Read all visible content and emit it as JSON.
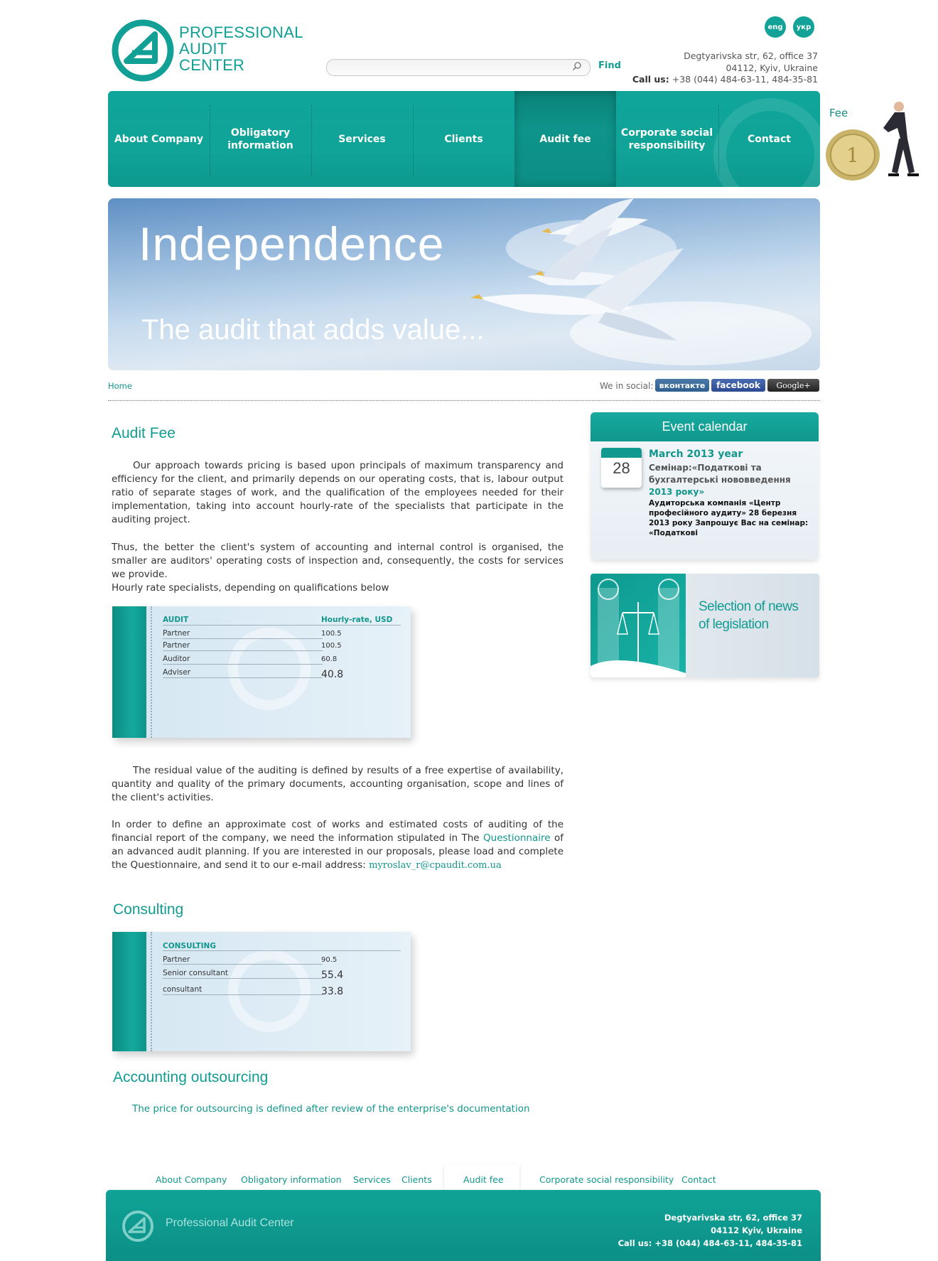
{
  "header": {
    "logo_lines": [
      "PROFESSIONAL",
      "AUDIT",
      "CENTER"
    ],
    "lang": [
      "eng",
      "укр"
    ],
    "search": {
      "value": "",
      "placeholder": ""
    },
    "find_label": "Find",
    "address": [
      "Degtyarivska str, 62, office 37",
      "04112, Kyiv, Ukraine"
    ],
    "call_label": "Call us:",
    "call_numbers": "+38 (044) 484-63-11, 484-35-81"
  },
  "nav": {
    "items": [
      "About Company",
      "Obligatory information",
      "Services",
      "Clients",
      "Audit fee",
      "Corporate social responsibility",
      "Contact"
    ],
    "active": "Audit fee",
    "fee_label": "Fee"
  },
  "banner": {
    "title": "Independence",
    "subtitle": "The audit that adds value..."
  },
  "breadcrumb": {
    "home": "Home"
  },
  "social": {
    "label": "We in social:",
    "vk": "вконтакте",
    "facebook": "facebook",
    "google": "Google+"
  },
  "audit_fee": {
    "heading": "Audit Fee",
    "p1": "Our approach towards pricing is based upon principals of maximum transparency and efficiency for the client, and primarily depends on our operating costs, that is, labour output ratio of separate stages of work, and the qualification of the employees needed for their implementation, taking into account hourly-rate of the specialists that participate in the auditing project.",
    "p2": "Thus, the better the client's system of accounting and internal control is organised, the smaller are auditors' operating costs of inspection and, consequently, the costs for services we provide.",
    "p3": "Hourly rate specialists, depending on qualifications below",
    "table": {
      "col1": "AUDIT",
      "col2": "Hourly-rate, USD",
      "rows": [
        {
          "role": "Partner",
          "rate": "100.5"
        },
        {
          "role": "Partner",
          "rate": "100.5"
        },
        {
          "role": "Auditor",
          "rate": "60.8"
        },
        {
          "role": "Adviser",
          "rate": "40.8"
        }
      ]
    },
    "p4": "The residual value of the auditing is defined by results of a free expertise of availability, quantity and quality of the primary documents, accounting organisation, scope and lines of the client's activities.",
    "p5_before": "In order to define an approximate cost of works and estimated costs of auditing of the financial report of the company, we need the information stipulated in The",
    "p5_link": "Questionnaire",
    "p5_after": "of an advanced audit planning. If you are interested in our proposals, please load and complete the Questionnaire, and send it to our e-mail address:",
    "email": "myroslav_r@cpaudit.com.ua"
  },
  "consulting": {
    "heading": "Consulting",
    "table": {
      "col1": "CONSULTING",
      "rows": [
        {
          "role": "Partner",
          "rate": "90.5"
        },
        {
          "role": "Senior consultant",
          "rate": "55.4"
        },
        {
          "role": "consultant",
          "rate": "33.8"
        }
      ]
    }
  },
  "outsourcing": {
    "heading": "Accounting outsourcing",
    "text": "The price for outsourcing is defined after review of the enterprise's documentation"
  },
  "sidebar": {
    "event_calendar": {
      "heading": "Event calendar",
      "day": "28",
      "month": "March 2013 year",
      "title_prefix": "Семінар:",
      "title_rest": "«Податкові та бухгалтерські нововведення",
      "title_year": "2013 року»",
      "text": "Аудиторська компанія «Центр професійного аудиту» 28 березня 2013 року   Запрошує Вас на семінар: «Податкові"
    },
    "news": {
      "line1": "Selection of news",
      "line2": "of legislation"
    }
  },
  "footer": {
    "nav": [
      "About Company",
      "Obligatory information",
      "Services",
      "Clients",
      "Audit fee",
      "Corporate social responsibility",
      "Contact"
    ],
    "active": "Audit fee",
    "name": "Professional Audit Center",
    "address": [
      "Degtyarivska str, 62, office 37",
      "04112 Kyiv, Ukraine"
    ],
    "call_label": "Call us:",
    "call_numbers": "+38 (044) 484-63-11, 484-35-81"
  },
  "colors": {
    "accent": "#10a499",
    "link": "#11968c",
    "text": "#333333"
  }
}
